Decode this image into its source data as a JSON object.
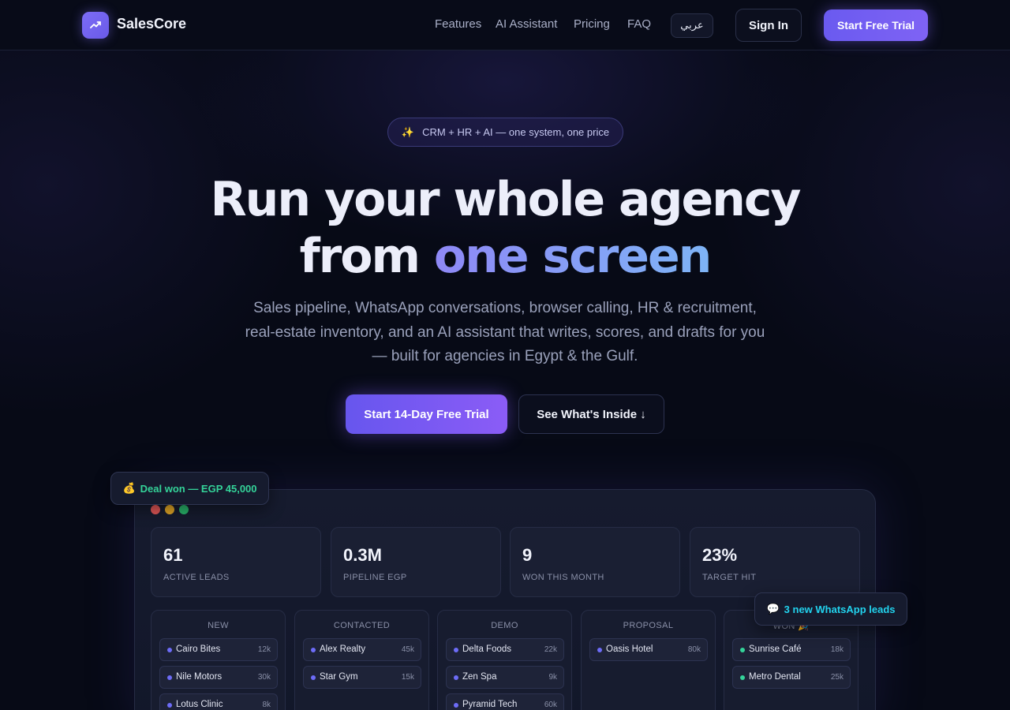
{
  "nav": {
    "logo_text": "SalesCore",
    "links": [
      "Features",
      "AI Assistant",
      "Pricing",
      "FAQ"
    ],
    "lang_label": "عربي",
    "signin_label": "Sign In",
    "trial_label": "Start Free Trial"
  },
  "hero": {
    "badge_icon": "✨",
    "badge_text": "CRM + HR + AI — one system, one price",
    "headline_line1": "Run your whole agency",
    "headline_line2_plain": "from",
    "headline_line2_accent": "one screen",
    "subtitle": "Sales pipeline, WhatsApp conversations, browser calling, HR & recruitment, real-estate inventory, and an AI assistant that writes, scores, and drafts for you — built for agencies in Egypt & the Gulf.",
    "cta_primary": "Start 14-Day Free Trial",
    "cta_secondary": "See What's Inside ↓"
  },
  "floating": {
    "deal_icon": "💰",
    "deal_text": "Deal won — EGP 45,000",
    "whatsapp_icon": "💬",
    "whatsapp_text": "3 new WhatsApp leads"
  },
  "dashboard": {
    "window_dots": [
      "#e25757",
      "#e0a526",
      "#29b36a"
    ],
    "stats": [
      {
        "value": "61",
        "label": "ACTIVE LEADS"
      },
      {
        "value": "0.3M",
        "label": "PIPELINE EGP"
      },
      {
        "value": "9",
        "label": "WON THIS MONTH"
      },
      {
        "value": "23%",
        "label": "TARGET HIT"
      }
    ],
    "columns": [
      {
        "title": "NEW",
        "dot_color": "#6d6cf7",
        "cards": [
          {
            "name": "Cairo Bites",
            "amount": "12k"
          },
          {
            "name": "Nile Motors",
            "amount": "30k"
          },
          {
            "name": "Lotus Clinic",
            "amount": "8k"
          }
        ]
      },
      {
        "title": "CONTACTED",
        "dot_color": "#6d6cf7",
        "cards": [
          {
            "name": "Alex Realty",
            "amount": "45k"
          },
          {
            "name": "Star Gym",
            "amount": "15k"
          }
        ]
      },
      {
        "title": "DEMO",
        "dot_color": "#6d6cf7",
        "cards": [
          {
            "name": "Delta Foods",
            "amount": "22k"
          },
          {
            "name": "Zen Spa",
            "amount": "9k"
          },
          {
            "name": "Pyramid Tech",
            "amount": "60k"
          }
        ]
      },
      {
        "title": "PROPOSAL",
        "dot_color": "#6d6cf7",
        "cards": [
          {
            "name": "Oasis Hotel",
            "amount": "80k"
          }
        ]
      },
      {
        "title": "WON 🎉",
        "dot_color": "#34d399",
        "cards": [
          {
            "name": "Sunrise Café",
            "amount": "18k"
          },
          {
            "name": "Metro Dental",
            "amount": "25k"
          }
        ]
      }
    ]
  },
  "colors": {
    "accent": "#7c6cf6",
    "success": "#34d399",
    "info": "#22d3ee"
  }
}
